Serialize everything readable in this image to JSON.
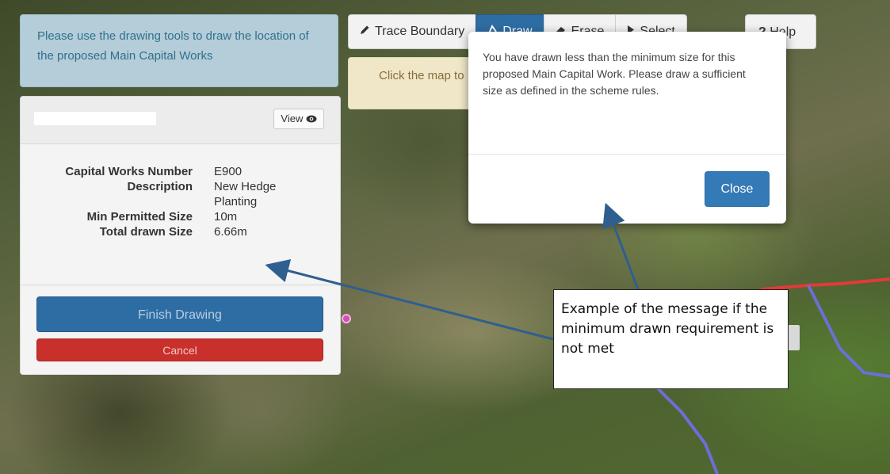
{
  "info_box": {
    "text": "Please use the drawing tools to draw the location of the proposed Main Capital Works"
  },
  "panel": {
    "view_label": "View",
    "view_icon": "eye-icon",
    "fields": [
      {
        "label": "Capital Works Number",
        "value": "E900"
      },
      {
        "label": "Description",
        "value": "New Hedge Planting"
      },
      {
        "label": "Min Permitted Size",
        "value": "10m"
      },
      {
        "label": "Total drawn Size",
        "value": "6.66m"
      }
    ],
    "finish_label": "Finish Drawing",
    "cancel_label": "Cancel"
  },
  "toolbar": {
    "trace_label": "Trace Boundary",
    "draw_label": "Draw",
    "erase_label": "Erase",
    "select_label": "Select",
    "help_label": "Help",
    "hint_text": "Click the map to"
  },
  "modal": {
    "message": "You have drawn less than the minimum size for this proposed Main Capital Work. Please draw a sufficient size as defined in the scheme rules.",
    "close_label": "Close"
  },
  "callout": {
    "text": "Example of the message if the minimum drawn requirement is not met"
  },
  "colors": {
    "primary": "#337ab7",
    "danger": "#c9302c",
    "info_bg": "#b4cdd8",
    "warning_bg": "#efe7c8",
    "arrow": "#2f5f8f"
  }
}
